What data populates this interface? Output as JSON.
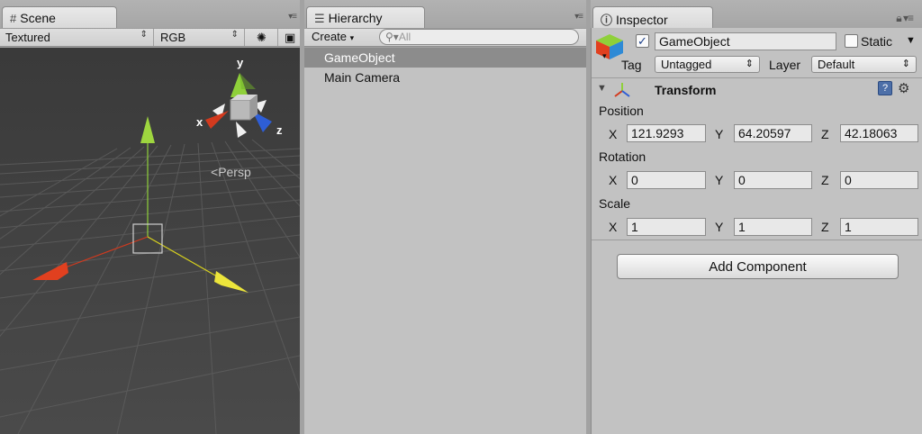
{
  "scene": {
    "tab_label": "Scene",
    "shading_mode": "Textured",
    "render_mode": "RGB",
    "persp_label": "Persp",
    "axis_x": "x",
    "axis_y": "y",
    "axis_z": "z"
  },
  "hierarchy": {
    "tab_label": "Hierarchy",
    "create_label": "Create",
    "search_placeholder": "All",
    "items": [
      {
        "label": "GameObject",
        "selected": true
      },
      {
        "label": "Main Camera",
        "selected": false
      }
    ]
  },
  "inspector": {
    "tab_label": "Inspector",
    "object_name": "GameObject",
    "active_checked": true,
    "static_label": "Static",
    "tag_label": "Tag",
    "tag_value": "Untagged",
    "layer_label": "Layer",
    "layer_value": "Default",
    "component_title": "Transform",
    "position_label": "Position",
    "rotation_label": "Rotation",
    "scale_label": "Scale",
    "axis_x": "X",
    "axis_y": "Y",
    "axis_z": "Z",
    "position": {
      "x": "121.9293",
      "y": "64.20597",
      "z": "42.18063"
    },
    "rotation": {
      "x": "0",
      "y": "0",
      "z": "0"
    },
    "scale": {
      "x": "1",
      "y": "1",
      "z": "1"
    },
    "add_component_label": "Add Component"
  },
  "colors": {
    "x_axis": "#d33a1e",
    "y_axis": "#8fd03a",
    "z_axis": "#2e5ed6",
    "scene_bg": "#474747",
    "selection": "#8c8c8c"
  }
}
